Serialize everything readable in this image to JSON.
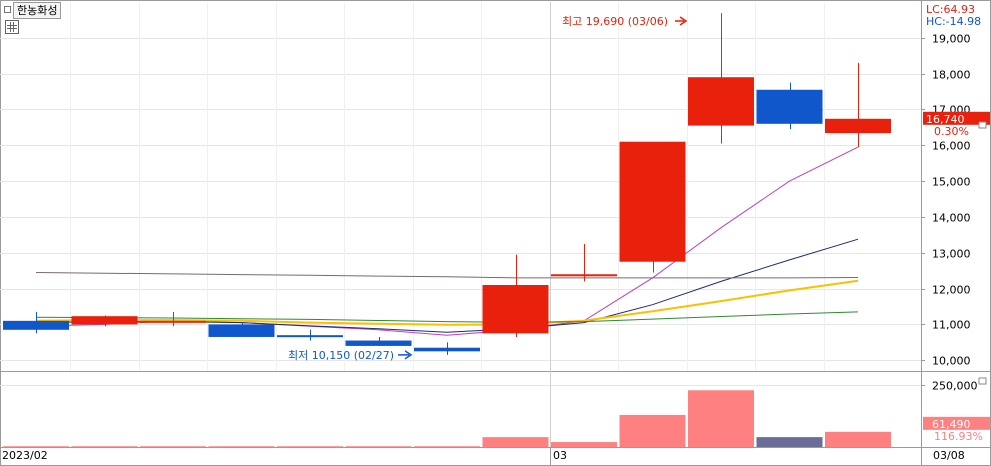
{
  "title": "한농화성",
  "colors": {
    "up": "#e8200c",
    "down": "#1157cc",
    "vol_up": "#ff8080",
    "vol_down": "#6c6c99",
    "ma5": "#c33cc3",
    "ma20": "#1a2a7a",
    "ma60": "#ffbf00",
    "ma120": "#2e8b2e",
    "ma240": "#7a6a6a",
    "grid": "#e6e6e6",
    "axis_text": "#000000"
  },
  "legend": {
    "lc": "LC:64.93",
    "hc": "HC:-14.98"
  },
  "current": {
    "price": "16,740",
    "change": "0.30%"
  },
  "volume_current": {
    "value": "61,490",
    "ratio": "116.93%"
  },
  "annotations": {
    "high": "최고 19,690 (03/06)",
    "low": "최저 10,150 (02/27)"
  },
  "x_labels": {
    "left": "2023/02",
    "mid": "03",
    "right": "03/08"
  },
  "chart_data": {
    "type": "candlestick",
    "title": "한농화성",
    "ylim": [
      9700,
      20000
    ],
    "y_ticks": [
      "10,000",
      "11,000",
      "12,000",
      "13,000",
      "14,000",
      "15,000",
      "16,000",
      "17,000",
      "18,000",
      "19,000"
    ],
    "candles": [
      {
        "open": 11100,
        "high": 11350,
        "low": 10750,
        "close": 10850
      },
      {
        "open": 11000,
        "high": 11250,
        "low": 10950,
        "close": 11230
      },
      {
        "open": 11100,
        "high": 11350,
        "low": 10950,
        "close": 11100
      },
      {
        "open": 11000,
        "high": 11050,
        "low": 10650,
        "close": 10650
      },
      {
        "open": 10700,
        "high": 10850,
        "low": 10550,
        "close": 10650
      },
      {
        "open": 10550,
        "high": 10650,
        "low": 10400,
        "close": 10400
      },
      {
        "open": 10350,
        "high": 10500,
        "low": 10150,
        "close": 10250
      },
      {
        "open": 10750,
        "high": 12950,
        "low": 10650,
        "close": 12100
      },
      {
        "open": 12350,
        "high": 13250,
        "low": 12200,
        "close": 12400
      },
      {
        "open": 12750,
        "high": 14300,
        "low": 12450,
        "close": 16100
      },
      {
        "open": 16550,
        "high": 19690,
        "low": 16050,
        "close": 17900
      },
      {
        "open": 17550,
        "high": 17750,
        "low": 16450,
        "close": 16600
      },
      {
        "open": 16340,
        "high": 18300,
        "low": 15950,
        "close": 16740
      }
    ],
    "ma_series": [
      {
        "key": "ma5",
        "values": [
          10950,
          11000,
          11100,
          11050,
          10950,
          10850,
          10700,
          10850,
          11100,
          12300,
          13700,
          15000,
          15950
        ]
      },
      {
        "key": "ma20",
        "values": [
          11050,
          11080,
          11080,
          11050,
          10960,
          10880,
          10780,
          10880,
          11050,
          11550,
          12200,
          12800,
          13380
        ]
      },
      {
        "key": "ma60",
        "values": [
          11100,
          11120,
          11120,
          11100,
          11050,
          11020,
          10990,
          11000,
          11100,
          11370,
          11650,
          11950,
          12220
        ]
      },
      {
        "key": "ma120",
        "values": [
          11200,
          11190,
          11180,
          11160,
          11140,
          11110,
          11080,
          11060,
          11080,
          11150,
          11220,
          11290,
          11350
        ]
      },
      {
        "key": "ma240",
        "values": [
          12450,
          12430,
          12410,
          12390,
          12370,
          12350,
          12330,
          12300,
          12300,
          12300,
          12300,
          12300,
          12310
        ]
      }
    ],
    "volume": {
      "ylim": [
        0,
        300000
      ],
      "y_ticks": [
        "250,000"
      ],
      "values": [
        3000,
        3000,
        3000,
        3000,
        3000,
        3000,
        3000,
        40000,
        20000,
        130000,
        230000,
        40000,
        61490
      ],
      "up": [
        true,
        true,
        true,
        true,
        true,
        true,
        true,
        true,
        true,
        true,
        true,
        false,
        true
      ]
    }
  }
}
